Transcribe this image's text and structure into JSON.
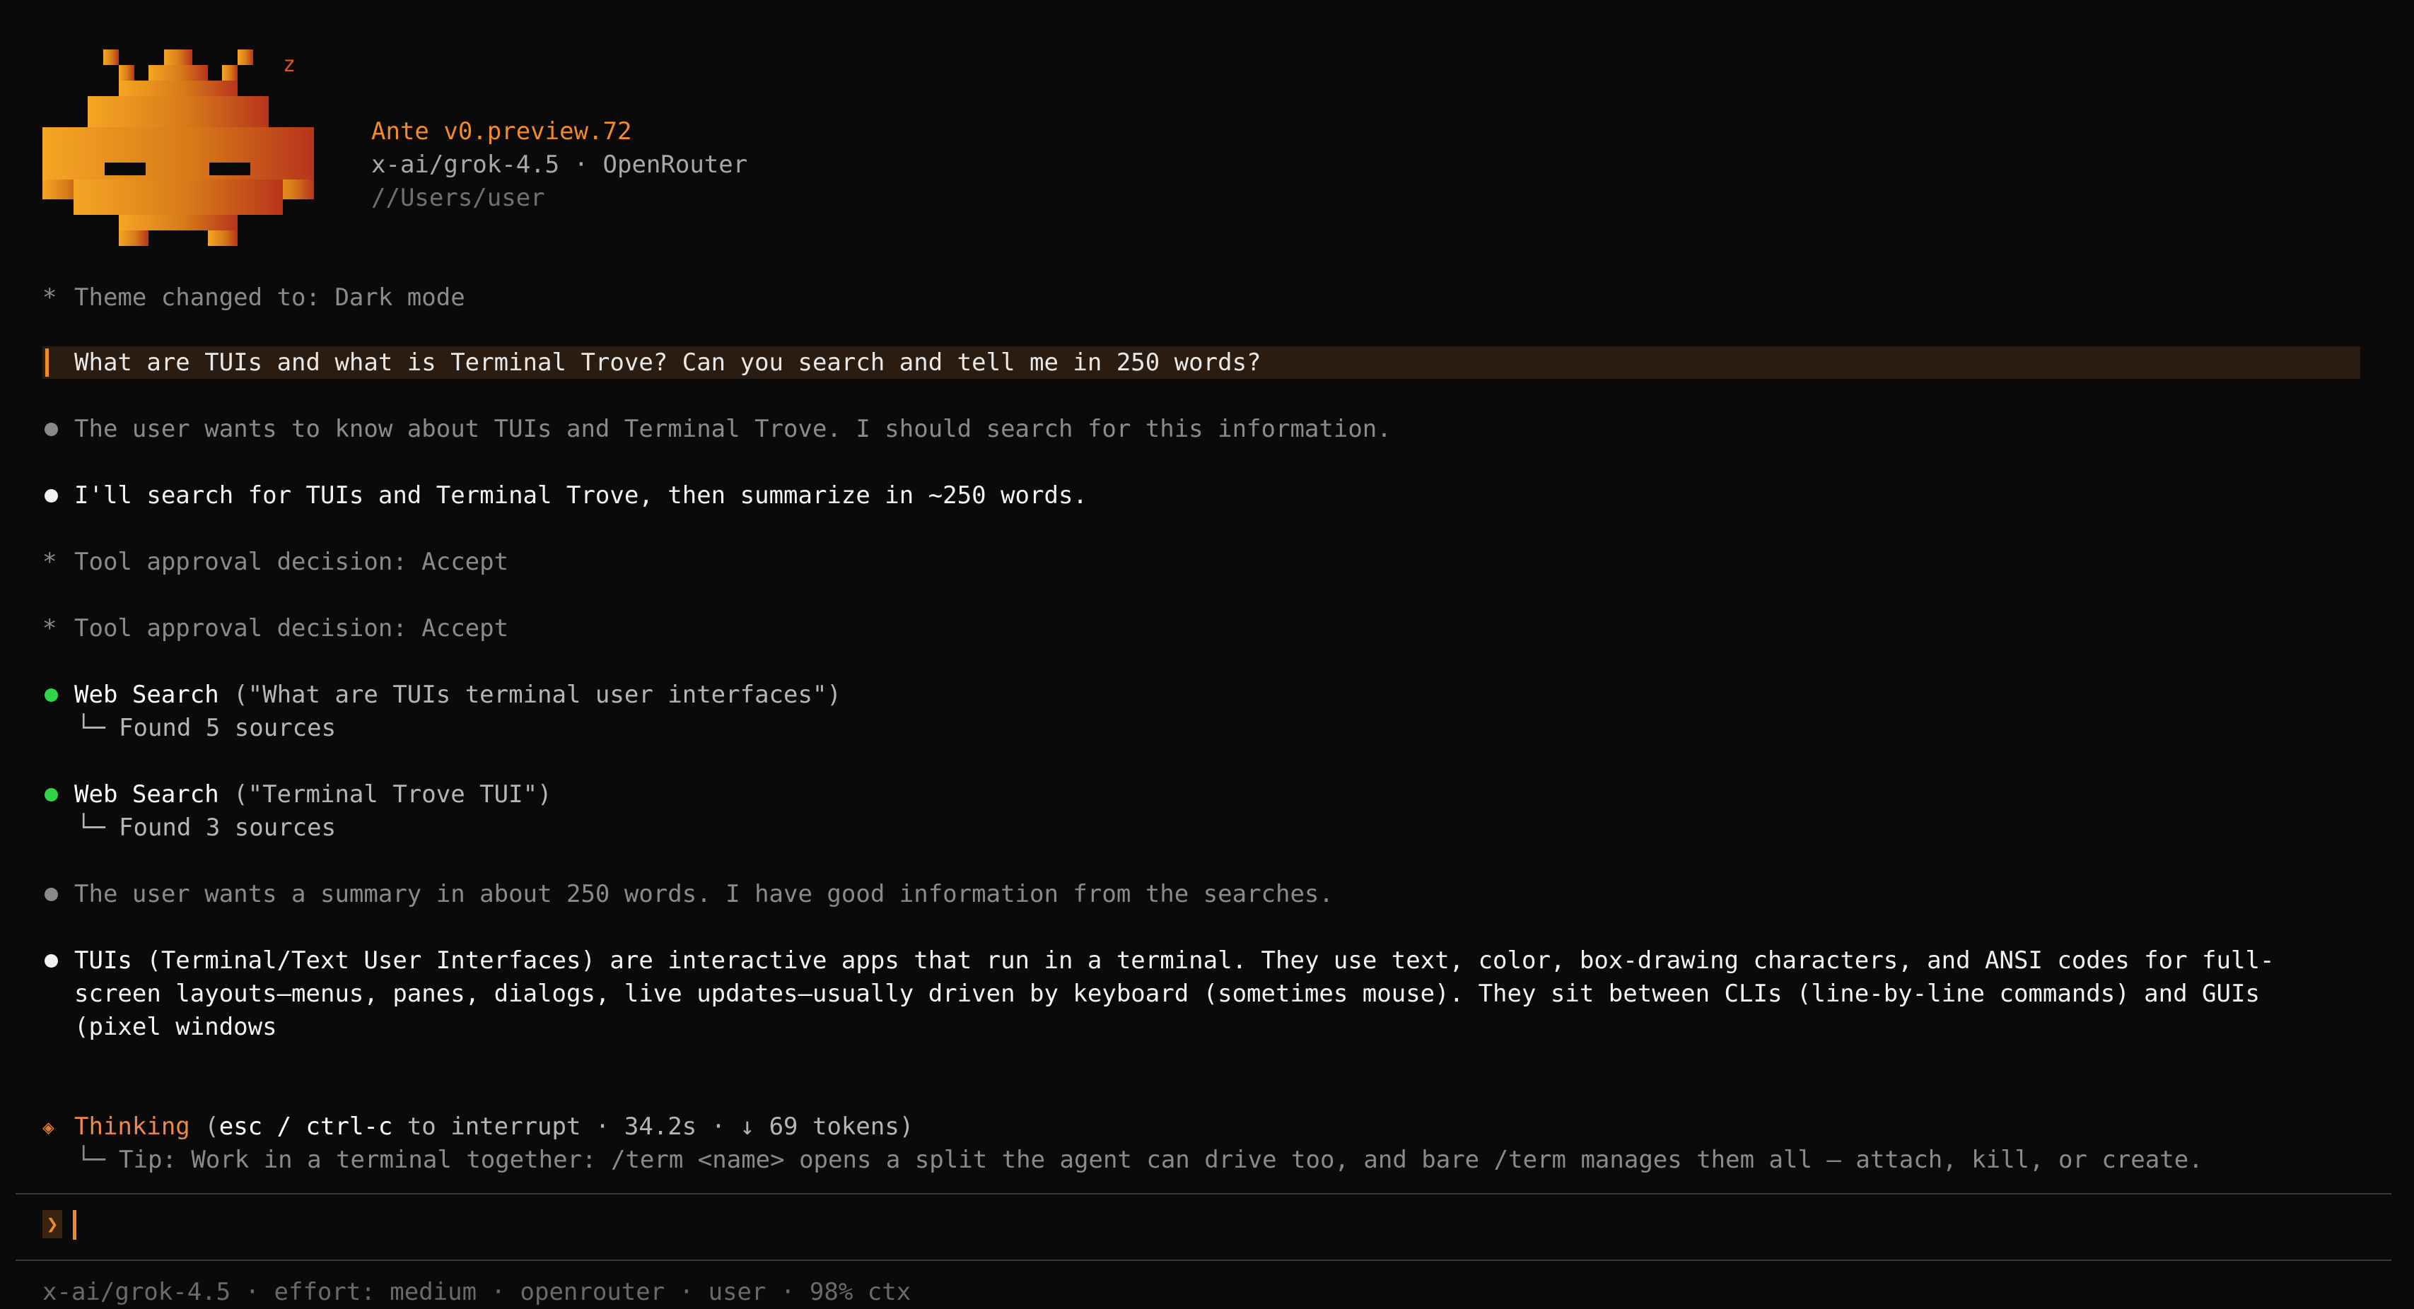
{
  "header": {
    "sleep_indicator": "z",
    "title": "Ante v0.preview.72",
    "model_provider": "x-ai/grok-4.5 · OpenRouter",
    "path": "//Users/user"
  },
  "transcript": {
    "theme_notice": {
      "glyph": "*",
      "text": "Theme changed to: Dark mode"
    },
    "user_message": "What are TUIs and what is Terminal Trove? Can you search and tell me in 250 words?",
    "thinking_1": "The user wants to know about TUIs and Terminal Trove. I should search for this information.",
    "assistant_1": "I'll search for TUIs and Terminal Trove, then summarize in ~250 words.",
    "approval_1": {
      "glyph": "*",
      "text": "Tool approval decision: Accept"
    },
    "approval_2": {
      "glyph": "*",
      "text": "Tool approval decision: Accept"
    },
    "tool_1": {
      "name": "Web Search",
      "args": " (\"What are TUIs terminal user interfaces\")",
      "branch": "└─",
      "result": "Found 5 sources"
    },
    "tool_2": {
      "name": "Web Search",
      "args": " (\"Terminal Trove TUI\")",
      "branch": "└─",
      "result": "Found 3 sources"
    },
    "thinking_2": "The user wants a summary in about 250 words. I have good information from the searches.",
    "assistant_2": {
      "lead": "TUIs",
      "line_1": " (Terminal/Text User Interfaces) are interactive apps that run in a terminal. They use text, color, box-drawing characters, and ANSI codes for full-",
      "line_2": "screen layouts—menus, panes, dialogs, live updates—usually driven by keyboard (sometimes mouse). They sit between CLIs (line-by-line commands) and GUIs",
      "line_3": "(pixel windows"
    }
  },
  "status": {
    "glyph": "◈",
    "label": "Thinking",
    "open_paren": " (",
    "keys": "esc / ctrl-c",
    "interrupt_text": " to interrupt · 34.2s · ↓ 69 tokens)",
    "branch": "└─",
    "tip": "Tip: Work in a terminal together: /term <name> opens a split the agent can drive too, and bare /term manages them all — attach, kill, or create."
  },
  "prompt": {
    "chevron": "❯",
    "value": ""
  },
  "footer": {
    "text": "x-ai/grok-4.5 · effort: medium · openrouter · user · 98% ctx"
  },
  "colors": {
    "background": "#0a0a0a",
    "accent_orange": "#f08a2c",
    "user_bar": "#2a1c10",
    "success_green": "#2fd64a",
    "muted_text": "#8a8a8a"
  }
}
